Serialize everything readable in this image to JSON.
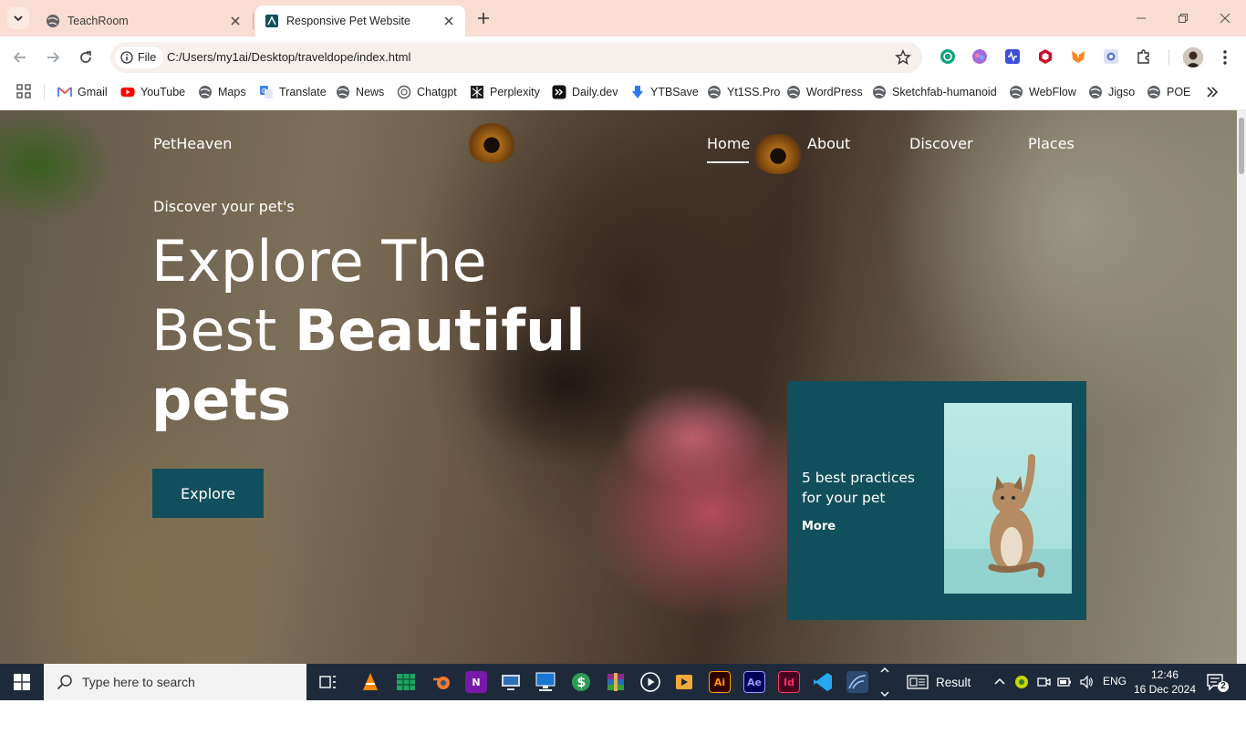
{
  "browser": {
    "tabs": [
      {
        "title": "TeachRoom",
        "active": false
      },
      {
        "title": "Responsive Pet Website",
        "active": true
      }
    ],
    "omnibox": {
      "chip_label": "File",
      "url": "C:/Users/my1ai/Desktop/traveldope/index.html"
    },
    "bookmarks": [
      {
        "label": "Gmail",
        "icon": "gmail-icon"
      },
      {
        "label": "YouTube",
        "icon": "youtube-icon"
      },
      {
        "label": "Maps",
        "icon": "globe-icon"
      },
      {
        "label": "Translate",
        "icon": "translate-icon"
      },
      {
        "label": "News",
        "icon": "globe-icon"
      },
      {
        "label": "Chatgpt",
        "icon": "chatgpt-icon"
      },
      {
        "label": "Perplexity",
        "icon": "perplexity-icon"
      },
      {
        "label": "Daily.dev",
        "icon": "dailydev-icon"
      },
      {
        "label": "YTBSave",
        "icon": "download-icon"
      },
      {
        "label": "Yt1SS.Pro",
        "icon": "globe-icon"
      },
      {
        "label": "WordPress",
        "icon": "globe-icon"
      },
      {
        "label": "Sketchfab-humanoid",
        "icon": "globe-icon"
      },
      {
        "label": "WebFlow",
        "icon": "globe-icon"
      },
      {
        "label": "Jigso",
        "icon": "globe-icon"
      },
      {
        "label": "POE",
        "icon": "globe-icon"
      }
    ],
    "colors": {
      "tabstrip": "#f9dcd2",
      "omnibox": "#f6efec"
    }
  },
  "page": {
    "logo": "PetHeaven",
    "nav": [
      {
        "label": "Home",
        "active": true
      },
      {
        "label": "About",
        "active": false
      },
      {
        "label": "Discover",
        "active": false
      },
      {
        "label": "Places",
        "active": false
      }
    ],
    "hero": {
      "eyebrow": "Discover your pet's",
      "headline_line1": "Explore The",
      "headline_line2_regular": "Best",
      "headline_line2_bold": "Beautiful",
      "headline_line3_bold": "pets",
      "cta_label": "Explore"
    },
    "card": {
      "title": "5 best practices for your pet",
      "link_label": "More"
    },
    "colors": {
      "accent": "#124f5c",
      "text": "#ffffff"
    }
  },
  "taskbar": {
    "search_placeholder": "Type here to search",
    "apps": [
      {
        "name": "task-view"
      },
      {
        "name": "vlc"
      },
      {
        "name": "sheets"
      },
      {
        "name": "blender"
      },
      {
        "name": "onenote"
      },
      {
        "name": "remote"
      },
      {
        "name": "network"
      },
      {
        "name": "money"
      },
      {
        "name": "winrar"
      },
      {
        "name": "media-player"
      },
      {
        "name": "video-editor"
      },
      {
        "name": "illustrator",
        "label": "Ai"
      },
      {
        "name": "after-effects",
        "label": "Ae"
      },
      {
        "name": "indesign",
        "label": "Id"
      },
      {
        "name": "vscode"
      },
      {
        "name": "mysql"
      }
    ],
    "widget_label": "Result",
    "language": "ENG",
    "time": "12:46",
    "date": "16 Dec 2024",
    "notification_count": "2"
  }
}
